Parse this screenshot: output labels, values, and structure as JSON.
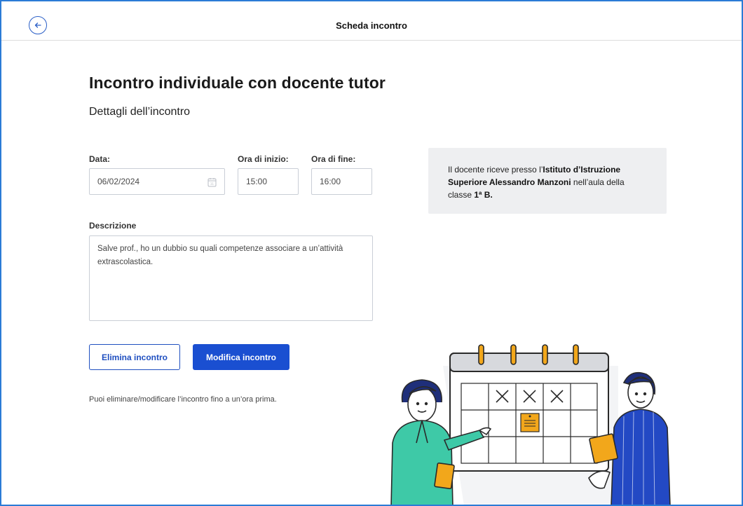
{
  "header": {
    "title": "Scheda incontro",
    "back_icon": "arrow-left-icon"
  },
  "main": {
    "title": "Incontro individuale con docente tutor",
    "subtitle": "Dettagli dell’incontro"
  },
  "form": {
    "date": {
      "label": "Data:",
      "value": "06/02/2024",
      "icon": "calendar-icon"
    },
    "start_time": {
      "label": "Ora di inizio:",
      "value": "15:00"
    },
    "end_time": {
      "label": "Ora di fine:",
      "value": "16:00"
    },
    "description": {
      "label": "Descrizione",
      "value": "Salve prof., ho un dubbio su quali competenze associare a un’attività extrascolastica."
    }
  },
  "actions": {
    "delete_label": "Elimina incontro",
    "edit_label": "Modifica incontro",
    "hint": "Puoi eliminare/modificare l’incontro fino a un’ora prima."
  },
  "info": {
    "prefix": "Il docente riceve presso l’",
    "institute": "Istituto d’Istruzione Superiore Alessandro Manzoni",
    "middle": " nell’aula della classe ",
    "classroom": "1ª B",
    "suffix": "."
  },
  "colors": {
    "primary": "#1a4fd1",
    "border": "#2b7bd6",
    "info_bg": "#eeeff1",
    "calendar_ring": "#f2a71b"
  }
}
